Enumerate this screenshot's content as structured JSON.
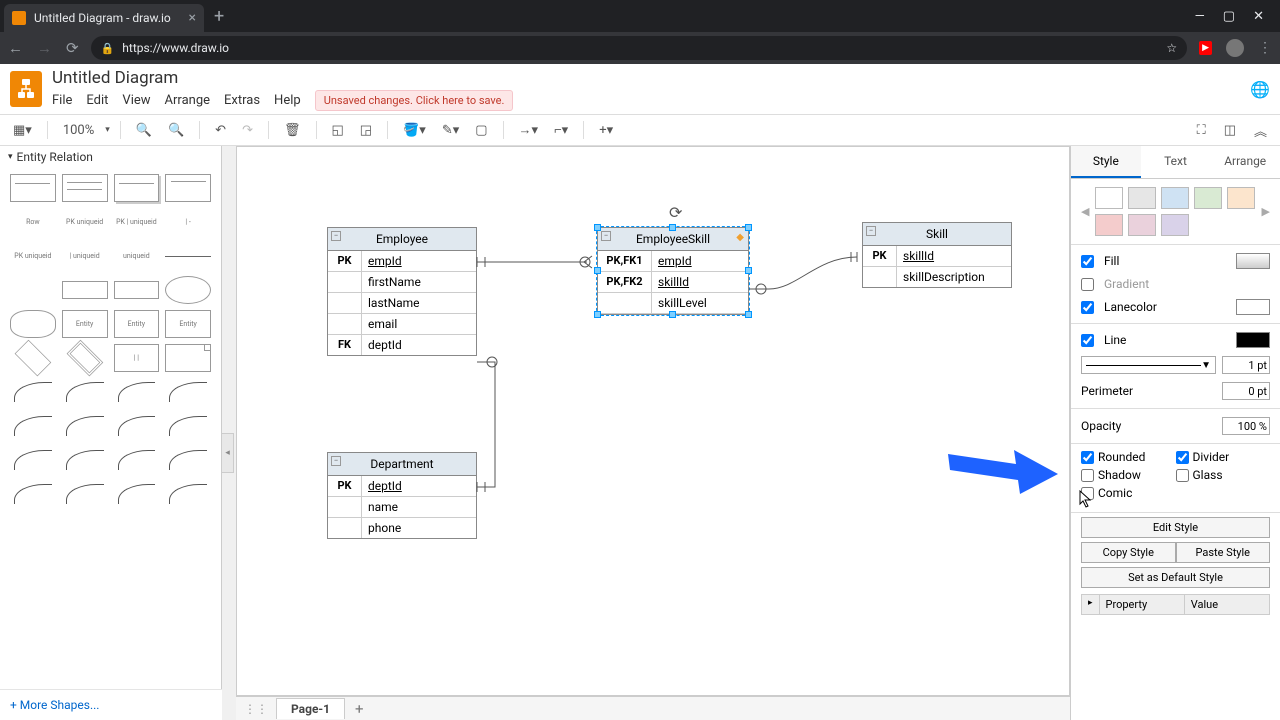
{
  "browser": {
    "tab_title": "Untitled Diagram - draw.io",
    "url": "https://www.draw.io",
    "star": "☆",
    "youtube": "▶"
  },
  "app": {
    "title": "Untitled Diagram",
    "menus": [
      "File",
      "Edit",
      "View",
      "Arrange",
      "Extras",
      "Help"
    ],
    "unsaved_msg": "Unsaved changes. Click here to save."
  },
  "toolbar": {
    "zoom": "100%"
  },
  "sidebar": {
    "category": "Entity Relation",
    "row_label": "Row",
    "more": "+ More Shapes..."
  },
  "canvas": {
    "employee": {
      "title": "Employee",
      "rows": [
        {
          "k": "PK",
          "v": "empId",
          "u": true
        },
        {
          "k": "",
          "v": "firstName"
        },
        {
          "k": "",
          "v": "lastName"
        },
        {
          "k": "",
          "v": "email"
        },
        {
          "k": "FK",
          "v": "deptId"
        }
      ]
    },
    "employeeSkill": {
      "title": "EmployeeSkill",
      "rows": [
        {
          "k": "PK,FK1",
          "v": "empId",
          "u": true
        },
        {
          "k": "PK,FK2",
          "v": "skillId",
          "u": true
        },
        {
          "k": "",
          "v": "skillLevel"
        }
      ]
    },
    "skill": {
      "title": "Skill",
      "rows": [
        {
          "k": "PK",
          "v": "skillId",
          "u": true
        },
        {
          "k": "",
          "v": "skillDescription"
        }
      ]
    },
    "department": {
      "title": "Department",
      "rows": [
        {
          "k": "PK",
          "v": "deptId",
          "u": true
        },
        {
          "k": "",
          "v": "name"
        },
        {
          "k": "",
          "v": "phone"
        }
      ]
    }
  },
  "pages": {
    "p1": "Page-1"
  },
  "right": {
    "tabs": [
      "Style",
      "Text",
      "Arrange"
    ],
    "swatch_colors": [
      "#ffffff",
      "#e6e6e6",
      "#cfe2f3",
      "#d9ead3",
      "#fce5cd",
      "#f4cccc",
      "#ead1dc",
      "#d9d2e9"
    ],
    "fill": "Fill",
    "gradient": "Gradient",
    "lanecolor": "Lanecolor",
    "line": "Line",
    "line_width": "1 pt",
    "perimeter": "Perimeter",
    "perimeter_val": "0 pt",
    "opacity": "Opacity",
    "opacity_val": "100 %",
    "rounded": "Rounded",
    "divider": "Divider",
    "shadow": "Shadow",
    "glass": "Glass",
    "comic": "Comic",
    "edit_style": "Edit Style",
    "copy_style": "Copy Style",
    "paste_style": "Paste Style",
    "default_style": "Set as Default Style",
    "property": "Property",
    "value": "Value"
  }
}
